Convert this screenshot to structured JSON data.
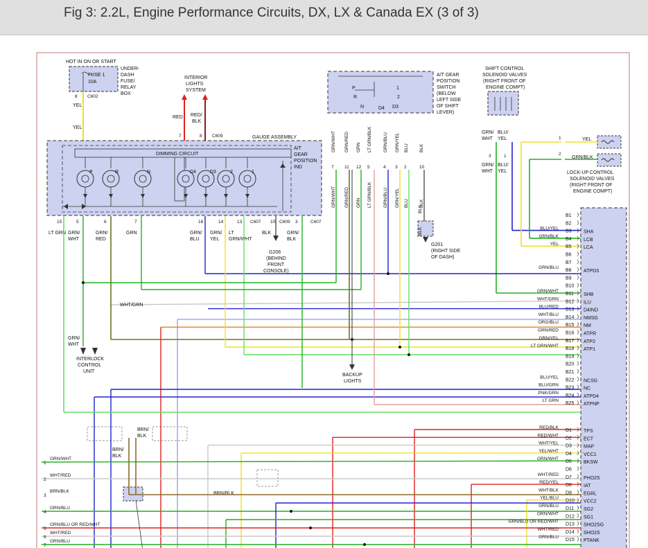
{
  "title": "Fig 3: 2.2L, Engine Performance Circuits, DX, LX & Canada EX (3 of 3)",
  "colors": {
    "box_fill": "#cdd2f0",
    "box_stroke": "#333333",
    "yel": "#f0e020",
    "red": "#e02020",
    "grn": "#20b020",
    "blu": "#2020d0",
    "brn": "#8a6a2a",
    "olive": "#707020",
    "wht": "#c8c8c8",
    "pnk": "#e0a0a0",
    "org": "#e08020",
    "ltgrn": "#60e060"
  },
  "labels": {
    "fuse_power": "HOT IN ON OR START",
    "fuse_name": "FUSE 1",
    "fuse_amp": "10A",
    "fuse_box_1": "UNDER-",
    "fuse_box_2": "DASH",
    "fuse_box_3": "FUSE/",
    "fuse_box_4": "RELAY",
    "fuse_box_5": "BOX",
    "interior_1": "INTERIOR",
    "interior_2": "LIGHTS",
    "interior_3": "SYSTEM",
    "gauge_assembly": "GAUGE ASSEMBLY",
    "dimming": "DIMMING CIRCUIT",
    "atgear_ind_1": "A/T",
    "atgear_ind_2": "GEAR",
    "atgear_ind_3": "POSITION",
    "atgear_ind_4": "IND",
    "switch_1": "A/T GEAR",
    "switch_2": "POSITION",
    "switch_3": "SWITCH",
    "switch_4": "(BELOW",
    "switch_5": "LEFT SIDE",
    "switch_6": "OF SHIFT",
    "switch_7": "LEVER)",
    "shift_sol_1": "SHIFT CONTROL",
    "shift_sol_2": "SOLENOID VALVES",
    "shift_sol_3": "(RIGHT FRONT OF",
    "shift_sol_4": "ENGINE COMPT)",
    "lockup_1": "LOCK-UP CONTROL",
    "lockup_2": "SOLENOID VALVES",
    "lockup_3": "(RIGHT FRONT OF",
    "lockup_4": "ENGINE COMPT)",
    "g206_1": "G206",
    "g206_2": "(BEHIND",
    "g206_3": "FRONT",
    "g206_4": "CONSOLE)",
    "g201_1": "G201",
    "g201_2": "(RIGHT SIDE",
    "g201_3": "OF DASH)",
    "interlock_1": "INTERLOCK",
    "interlock_2": "CONTROL",
    "interlock_3": "UNIT",
    "backup_1": "BACKUP",
    "backup_2": "LIGHTS",
    "c602": "C602",
    "c609": "C609",
    "c607": "C607"
  },
  "lamps": [
    "P",
    "R",
    "N",
    "D4",
    "D3",
    "2",
    "1"
  ],
  "switch_positions": [
    "P",
    "R",
    "N",
    "D4",
    "D3",
    "2",
    "1"
  ],
  "ecm_pins": [
    {
      "pin": "B1",
      "wire": "",
      "sig": ""
    },
    {
      "pin": "B2",
      "wire": "",
      "sig": ""
    },
    {
      "pin": "B3",
      "wire": "BLU/YEL",
      "sig": "SHA"
    },
    {
      "pin": "B4",
      "wire": "GRN/BLK",
      "sig": "LCB"
    },
    {
      "pin": "B5",
      "wire": "YEL",
      "sig": "LCA"
    },
    {
      "pin": "B6",
      "wire": "",
      "sig": ""
    },
    {
      "pin": "B7",
      "wire": "",
      "sig": ""
    },
    {
      "pin": "B8",
      "wire": "GRN/BLU",
      "sig": "ATPD3"
    },
    {
      "pin": "B9",
      "wire": "",
      "sig": ""
    },
    {
      "pin": "B10",
      "wire": "",
      "sig": ""
    },
    {
      "pin": "B11",
      "wire": "GRN/WHT",
      "sig": "SHB"
    },
    {
      "pin": "B12",
      "wire": "WHT/GRN",
      "sig": "ILU"
    },
    {
      "pin": "B13",
      "wire": "BLU/RED",
      "sig": "D4IND"
    },
    {
      "pin": "B14",
      "wire": "WHT/BLU",
      "sig": "NMSG"
    },
    {
      "pin": "B15",
      "wire": "ORG/BLU",
      "sig": "NM"
    },
    {
      "pin": "B16",
      "wire": "GRN/RED",
      "sig": "ATPR"
    },
    {
      "pin": "B17",
      "wire": "GRN/YEL",
      "sig": "ATP2"
    },
    {
      "pin": "B18",
      "wire": "LT GRN/WHT",
      "sig": "ATP1"
    },
    {
      "pin": "B19",
      "wire": "",
      "sig": ""
    },
    {
      "pin": "B20",
      "wire": "",
      "sig": ""
    },
    {
      "pin": "B21",
      "wire": "",
      "sig": ""
    },
    {
      "pin": "B22",
      "wire": "BLU/YEL",
      "sig": "NCSG"
    },
    {
      "pin": "B23",
      "wire": "BLU/GRN",
      "sig": "NC"
    },
    {
      "pin": "B24",
      "wire": "PNK/GRN",
      "sig": "ATPD4"
    },
    {
      "pin": "B25",
      "wire": "LT GRN",
      "sig": "ATPNP"
    },
    {
      "pin": "D1",
      "wire": "RED/BLK",
      "sig": "TPS"
    },
    {
      "pin": "D2",
      "wire": "RED/WHT",
      "sig": "ECT"
    },
    {
      "pin": "D3",
      "wire": "WHT/YEL",
      "sig": "MAP"
    },
    {
      "pin": "D4",
      "wire": "YEL/WHT",
      "sig": "VCC1"
    },
    {
      "pin": "D5",
      "wire": "GRN/WHT",
      "sig": "BKSW"
    },
    {
      "pin": "D6",
      "wire": "",
      "sig": ""
    },
    {
      "pin": "D7",
      "wire": "WHT/RED",
      "sig": "PHO2S"
    },
    {
      "pin": "D8",
      "wire": "RED/YEL",
      "sig": "IAT"
    },
    {
      "pin": "D9",
      "wire": "WHT/BLK",
      "sig": "EGRL"
    },
    {
      "pin": "D10",
      "wire": "YEL/BLU",
      "sig": "VCC2"
    },
    {
      "pin": "D11",
      "wire": "GRN/BLU",
      "sig": "SG2"
    },
    {
      "pin": "D12",
      "wire": "GRN/WHT",
      "sig": "SG1"
    },
    {
      "pin": "D13",
      "wire": "GRN/BLU OR RED/WHT",
      "sig": "SHO2SG"
    },
    {
      "pin": "D14",
      "wire": "WHT/RED",
      "sig": "SHO2S"
    },
    {
      "pin": "D15",
      "wire": "GRN/BLU",
      "sig": "PTANK"
    }
  ],
  "left_edge_wires": [
    {
      "num": "1",
      "label": "GRN/WHT"
    },
    {
      "num": "2",
      "label": "WHT/RED"
    },
    {
      "num": "3",
      "label": "BRN/BLK"
    },
    {
      "num": "4",
      "label": "GRN/BLU"
    },
    {
      "num": "5",
      "label": "GRN/BLU OR RED/WHT"
    },
    {
      "num": "6",
      "label": "WHT/RED"
    },
    {
      "num": "7",
      "label": "GRN/BLU"
    }
  ],
  "gauge_bottom_pins": [
    {
      "num": "15",
      "wire1": "LT GRN",
      "wire2": ""
    },
    {
      "num": "5",
      "wire1": "GRN/",
      "wire2": "WHT"
    },
    {
      "num": "6",
      "wire1": "GRN/",
      "wire2": "RED"
    },
    {
      "num": "7",
      "wire1": "GRN",
      "wire2": ""
    },
    {
      "num": "16",
      "wire1": "GRN/",
      "wire2": "BLU"
    },
    {
      "num": "14",
      "wire1": "GRN/",
      "wire2": "YEL"
    },
    {
      "num": "13",
      "wire1": "LT",
      "wire2": "GRN/WHT"
    },
    {
      "num": "10",
      "wire1": "BLK",
      "wire2": ""
    },
    {
      "num": "3",
      "wire1": "GRN/",
      "wire2": "BLK"
    }
  ],
  "switch_pins": [
    {
      "num": "7",
      "wire": "GRN/WHT"
    },
    {
      "num": "11",
      "wire": "GRN/RED"
    },
    {
      "num": "12",
      "wire": "GRN"
    },
    {
      "num": "5",
      "wire": "LT GRN/BLK"
    },
    {
      "num": "4",
      "wire": "GRN/BLU"
    },
    {
      "num": "3",
      "wire": "GRN/YEL"
    },
    {
      "num": "2",
      "wire": "BLU"
    },
    {
      "num": "10",
      "wire": "BLK"
    }
  ],
  "misc_labels": {
    "yel": "YEL",
    "red": "RED",
    "red_blk_1": "RED/",
    "red_blk_2": "BLK",
    "wht_grn": "WHT/GRN",
    "grn_wht_1": "GRN/",
    "grn_wht_2": "WHT",
    "brn_blk_1": "BRN/",
    "brn_blk_2": "BLK",
    "brn_blk": "BRN/BLK",
    "blk": "BLK",
    "yel_sol": "YEL",
    "grn_blk_sol": "GRN/BLK",
    "blu_yel_1": "BLU/",
    "blu_yel_2": "YEL",
    "grn_wht_sol_1": "GRN/",
    "grn_wht_sol_2": "WHT"
  }
}
